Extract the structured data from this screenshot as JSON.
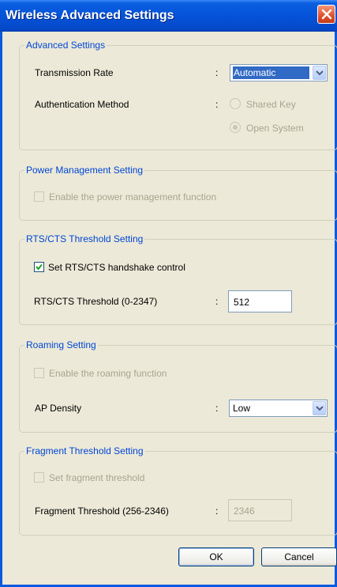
{
  "window": {
    "title": "Wireless Advanced Settings"
  },
  "advanced": {
    "legend": "Advanced Settings",
    "transmission_rate_label": "Transmission Rate",
    "transmission_rate_value": "Automatic",
    "auth_label": "Authentication Method",
    "auth_options": [
      "Shared Key",
      "Open System"
    ],
    "auth_selected": "Open System"
  },
  "power": {
    "legend": "Power Management Setting",
    "enable_label": "Enable the power management function",
    "enabled": false
  },
  "rts": {
    "legend": "RTS/CTS Threshold Setting",
    "handshake_label": "Set RTS/CTS handshake control",
    "handshake_checked": true,
    "threshold_label": "RTS/CTS Threshold (0-2347)",
    "threshold_value": "512"
  },
  "roaming": {
    "legend": "Roaming Setting",
    "enable_label": "Enable the roaming function",
    "enabled": false,
    "ap_density_label": "AP Density",
    "ap_density_value": "Low"
  },
  "fragment": {
    "legend": "Fragment Threshold Setting",
    "set_label": "Set fragment threshold",
    "set_checked": false,
    "threshold_label": "Fragment Threshold (256-2346)",
    "threshold_value": "2346"
  },
  "colon": ":",
  "buttons": {
    "ok": "OK",
    "cancel": "Cancel"
  }
}
